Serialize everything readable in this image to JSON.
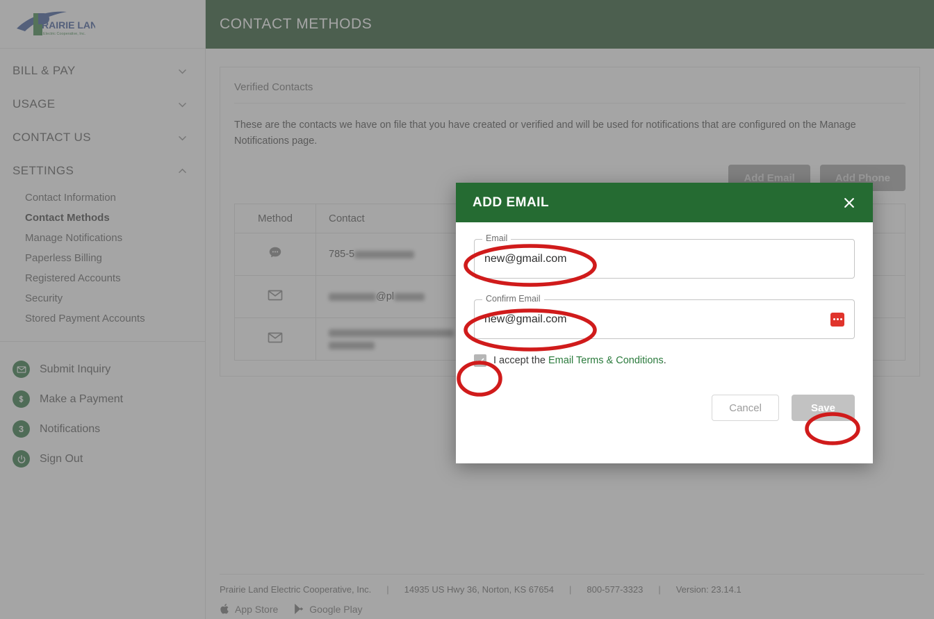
{
  "brand": {
    "name": "PRAIRIE LAND",
    "tagline": "Electric Cooperative, Inc."
  },
  "header": {
    "title": "CONTACT METHODS"
  },
  "sidebar": {
    "groups": [
      {
        "label": "BILL & PAY",
        "icon": "chevron-down-icon",
        "expanded": false
      },
      {
        "label": "USAGE",
        "icon": "chevron-down-icon",
        "expanded": false
      },
      {
        "label": "CONTACT US",
        "icon": "chevron-down-icon",
        "expanded": false
      },
      {
        "label": "SETTINGS",
        "icon": "chevron-up-icon",
        "expanded": true
      }
    ],
    "settings_items": [
      {
        "label": "Contact Information",
        "active": false
      },
      {
        "label": "Contact Methods",
        "active": true
      },
      {
        "label": "Manage Notifications",
        "active": false
      },
      {
        "label": "Paperless Billing",
        "active": false
      },
      {
        "label": "Registered Accounts",
        "active": false
      },
      {
        "label": "Security",
        "active": false
      },
      {
        "label": "Stored Payment Accounts",
        "active": false
      }
    ],
    "quick_items": [
      {
        "label": "Submit Inquiry",
        "icon": "envelope-icon"
      },
      {
        "label": "Make a Payment",
        "icon": "dollar-icon"
      },
      {
        "label": "Notifications",
        "icon": "badge-count-icon",
        "count": "3"
      },
      {
        "label": "Sign Out",
        "icon": "power-icon"
      }
    ]
  },
  "main": {
    "card_title": "Verified Contacts",
    "description": "These are the contacts we have on file that you have created or verified and will be used for notifications that are configured on the Manage Notifications page.",
    "add_email_label": "Add Email",
    "add_phone_label": "Add Phone",
    "table": {
      "columns": [
        "Method",
        "Contact"
      ],
      "rows": [
        {
          "method_icon": "sms-bubble-icon",
          "contact": "785-5",
          "redacted": true
        },
        {
          "method_icon": "envelope-icon",
          "contact": "@pl",
          "redacted": true
        },
        {
          "method_icon": "envelope-icon",
          "contact": "",
          "redacted": true
        }
      ]
    }
  },
  "modal": {
    "title": "ADD EMAIL",
    "close_icon": "close-icon",
    "email_field": {
      "legend": "Email",
      "value": "new@gmail.com"
    },
    "confirm_field": {
      "legend": "Confirm Email",
      "value": "new@gmail.com",
      "icon": "password-manager-icon"
    },
    "consent": {
      "prefix": "I accept the ",
      "link": "Email Terms & Conditions",
      "suffix": "."
    },
    "cancel_label": "Cancel",
    "save_label": "Save"
  },
  "footer": {
    "company": "Prairie Land Electric Cooperative, Inc.",
    "address": "14935 US Hwy 36, Norton, KS 67654",
    "phone": "800-577-3323",
    "version": "Version: 23.14.1",
    "separator": "|",
    "app_store": "App Store",
    "google_play": "Google Play"
  },
  "colors": {
    "header_green": "#15491f",
    "modal_green": "#256b32",
    "accent_green": "#1e6b34",
    "annotation_red": "#d01b1b",
    "disabled_grey": "#c2c2c2"
  }
}
